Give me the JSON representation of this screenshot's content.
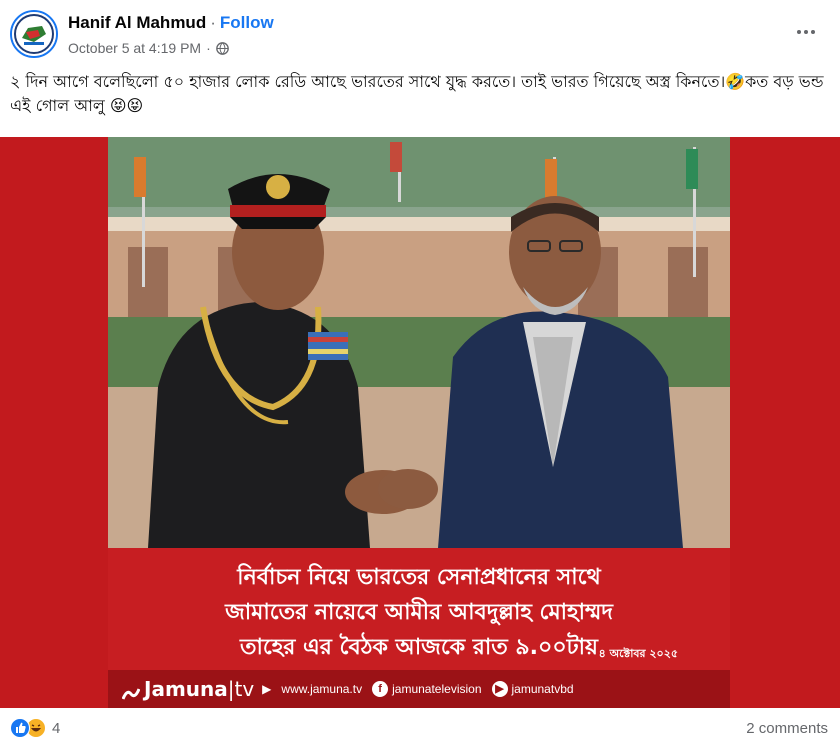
{
  "post": {
    "author": "Hanif Al Mahmud",
    "separator": "·",
    "follow_label": "Follow",
    "timestamp": "October 5 at 4:19 PM",
    "meta_separator": "·",
    "audience_icon": "globe-icon",
    "more_icon": "more-options-icon",
    "caption": "২ দিন আগে বলেছিলো ৫০ হাজার লোক রেডি আছে ভারতের সাথে যুদ্ধ করতে। তাই ভারত গিয়েছে অস্ত্র কিনতে।🤣কত বড় ভন্ড এই গোল আলু 😝😝"
  },
  "media": {
    "headline_lines": [
      "নির্বাচন নিয়ে ভারতের  সেনাপ্রধানের সাথে",
      "জামাতের নায়েবে আমীর আবদুল্লাহ মোহাম্মদ",
      "তাহের এর বৈঠক আজকে রাত ৯.০০টায়"
    ],
    "date": "৪ অক্টোবর ২০২৫",
    "brand": {
      "name": "Jamuna",
      "tv": "|tv",
      "website": "www.jamuna.tv",
      "facebook": "jamunatelevision",
      "youtube": "jamunatvbd"
    }
  },
  "engagement": {
    "reaction_icons": [
      "like-icon",
      "haha-icon"
    ],
    "reaction_count": "4",
    "comments": "2 comments"
  },
  "colors": {
    "accent": "#1877f2",
    "media_bg": "#c71e22",
    "brandbar": "#9b1216"
  }
}
